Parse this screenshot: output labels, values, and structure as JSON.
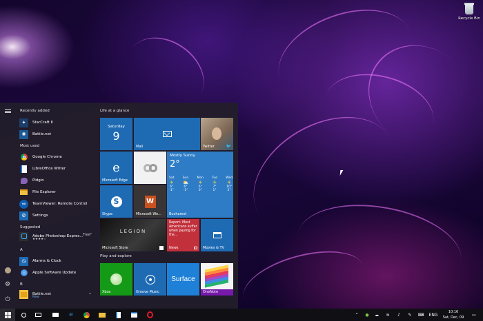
{
  "desktop": {
    "recycle_bin_label": "Recycle Bin"
  },
  "start_menu": {
    "sections": {
      "recently_added": "Recently added",
      "most_used": "Most used",
      "suggested": "Suggested",
      "a": "A",
      "b": "B"
    },
    "recent_apps": [
      {
        "name": "StarCraft II",
        "icon": "starcraft-icon"
      },
      {
        "name": "Battle.net",
        "icon": "battlenet-icon"
      }
    ],
    "most_used_apps": [
      {
        "name": "Google Chrome",
        "icon": "chrome-icon"
      },
      {
        "name": "LibreOffice Writer",
        "icon": "libreoffice-writer-icon"
      },
      {
        "name": "Pidgin",
        "icon": "pidgin-icon"
      },
      {
        "name": "File Explorer",
        "icon": "folder-icon"
      },
      {
        "name": "TeamViewer: Remote Control",
        "icon": "teamviewer-icon"
      },
      {
        "name": "Settings",
        "icon": "gear-icon"
      }
    ],
    "suggested_app": {
      "name": "Adobe Photoshop Expres...",
      "price": "Free*",
      "rating": "★★★★☆"
    },
    "a_apps": [
      {
        "name": "Alarms & Clock",
        "icon": "alarm-clock-icon"
      },
      {
        "name": "Apple Software Update",
        "icon": "apple-update-icon"
      }
    ],
    "b_apps": [
      {
        "name": "Battle.net",
        "sub": "New",
        "icon": "battlenet-icon"
      }
    ],
    "tile_groups": {
      "life": "Life at a glance",
      "play": "Play and explore"
    },
    "tiles": {
      "calendar_day": "Saturday",
      "calendar_date": "9",
      "mail": "Mail",
      "twitter": "Twitter",
      "edge": "Microsoft Edge",
      "skype": "Skype",
      "office": "Microsoft Wo...",
      "weather_cond": "Mostly Sunny",
      "weather_temp": "2°",
      "weather_city": "Bucharest",
      "forecast": [
        {
          "day": "Sat",
          "hi": "6°",
          "lo": "-1°"
        },
        {
          "day": "Sun",
          "hi": "6°",
          "lo": "-1°"
        },
        {
          "day": "Mon",
          "hi": "6°",
          "lo": "0°"
        },
        {
          "day": "Tue",
          "hi": "7°",
          "lo": "1°"
        },
        {
          "day": "Wed",
          "hi": "10°",
          "lo": "2°"
        }
      ],
      "store": "Microsoft Store",
      "store_banner": "LEGION",
      "news_headline": "Report: Most Americans suffer when paying for the...",
      "news": "News",
      "movies": "Movies & TV",
      "xbox": "Xbox",
      "groove": "Groove Music",
      "surface": "Surface",
      "onenote": "OneNote"
    }
  },
  "taskbar": {
    "language": "ENG",
    "time": "10:16",
    "date": "Sat, Dec, 09"
  },
  "colors": {
    "tile_blue": "#1e6bb4",
    "tile_red": "#c2303b",
    "xbox_green": "#149a16",
    "office_orange": "#c8501e"
  }
}
